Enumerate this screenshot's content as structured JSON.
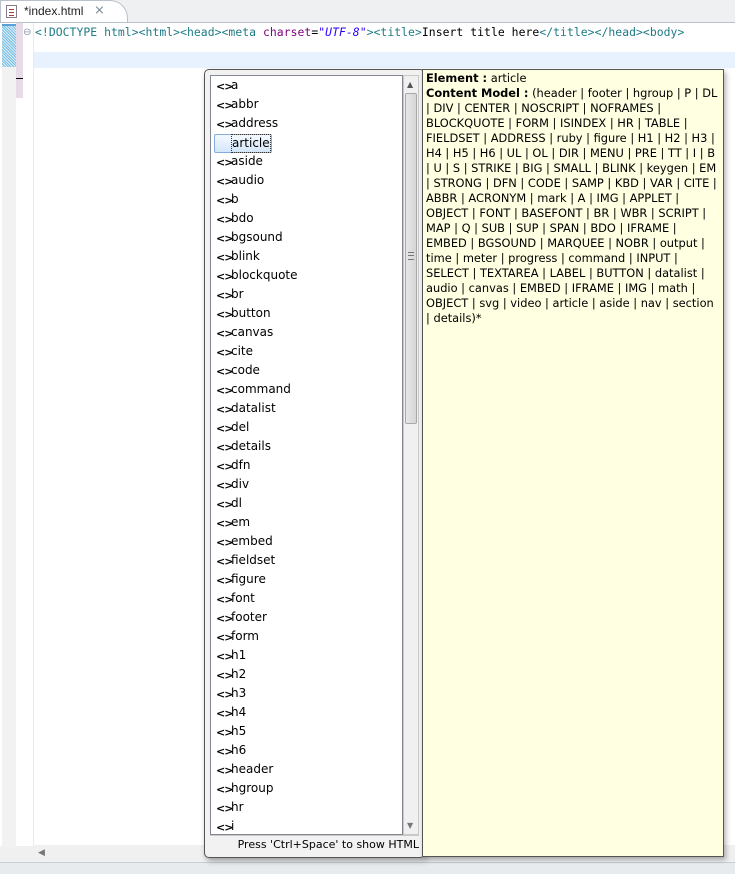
{
  "tab": {
    "title": "*index.html",
    "close_icon": "⨯"
  },
  "editor": {
    "code": [
      {
        "t": "tag",
        "v": "<!DOCTYPE "
      },
      {
        "t": "tag",
        "v": "html"
      },
      {
        "t": "tag",
        "v": "><html><head><meta "
      },
      {
        "t": "attr",
        "v": "charset"
      },
      {
        "t": "txt",
        "v": "="
      },
      {
        "t": "val",
        "v": "\"UTF-8\""
      },
      {
        "t": "tag",
        "v": "><title>"
      },
      {
        "t": "txt",
        "v": "Insert title here"
      },
      {
        "t": "tag",
        "v": "</title></head><body>"
      }
    ]
  },
  "autocomplete": {
    "icon": "<>",
    "selected": "article",
    "items": [
      "a",
      "abbr",
      "address",
      "article",
      "aside",
      "audio",
      "b",
      "bdo",
      "bgsound",
      "blink",
      "blockquote",
      "br",
      "button",
      "canvas",
      "cite",
      "code",
      "command",
      "datalist",
      "del",
      "details",
      "dfn",
      "div",
      "dl",
      "em",
      "embed",
      "fieldset",
      "figure",
      "font",
      "footer",
      "form",
      "h1",
      "h2",
      "h3",
      "h4",
      "h5",
      "h6",
      "header",
      "hgroup",
      "hr",
      "i"
    ],
    "hint": "Press 'Ctrl+Space' to show HTML"
  },
  "info": {
    "element_label": "Element :",
    "element_value": "article",
    "content_model_label": "Content Model :",
    "content_model_value": "(header | footer | hgroup | P | DL | DIV | CENTER | NOSCRIPT | NOFRAMES | BLOCKQUOTE | FORM | ISINDEX | HR | TABLE | FIELDSET | ADDRESS | ruby | figure | H1 | H2 | H3 | H4 | H5 | H6 | UL | OL | DIR | MENU | PRE | TT | I | B | U | S | STRIKE | BIG | SMALL | BLINK | keygen | EM | STRONG | DFN | CODE | SAMP | KBD | VAR | CITE | ABBR | ACRONYM | mark | A | IMG | APPLET | OBJECT | FONT | BASEFONT | BR | WBR | SCRIPT | MAP | Q | SUB | SUP | SPAN | BDO | IFRAME | EMBED | BGSOUND | MARQUEE | NOBR | output | time | meter | progress | command | INPUT | SELECT | TEXTAREA | LABEL | BUTTON | datalist | audio | canvas | EMBED | IFRAME | IMG | math | OBJECT | svg | video | article | aside | nav | section | details)*"
  }
}
